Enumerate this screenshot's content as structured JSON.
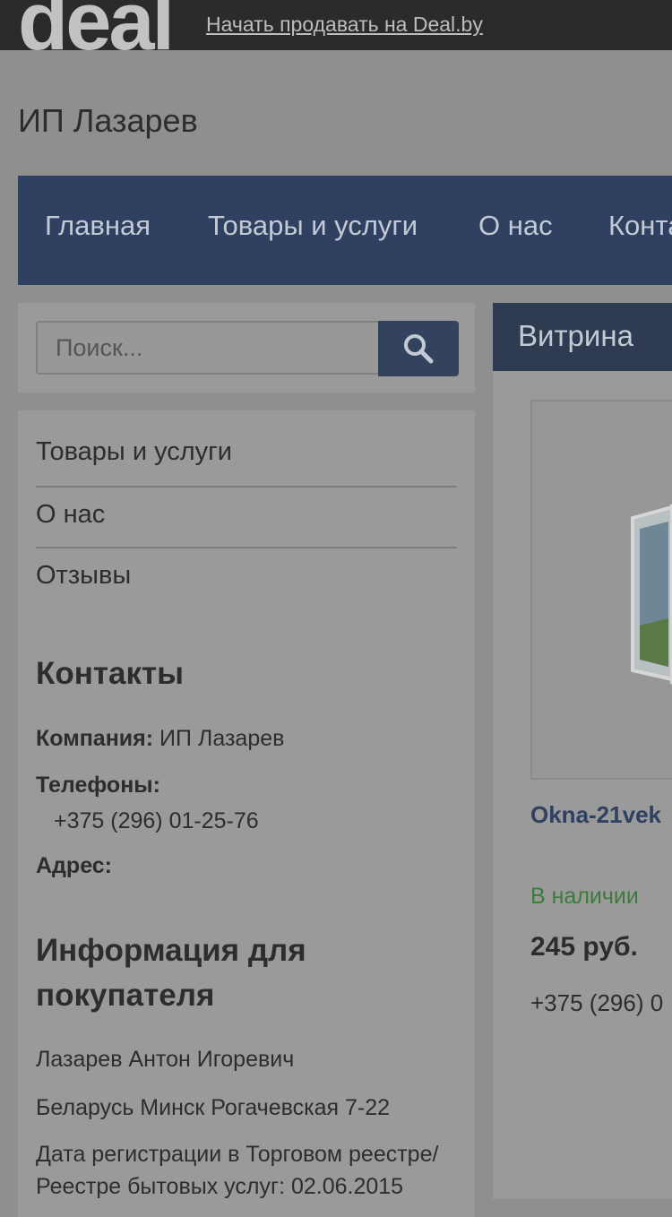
{
  "topbar": {
    "logo": "deal",
    "sell_link": "Начать продавать на Deal.by"
  },
  "shop": {
    "name": "ИП Лазарев"
  },
  "nav": {
    "items": [
      "Главная",
      "Товары и услуги",
      "О нас",
      "Конта"
    ]
  },
  "search": {
    "placeholder": "Поиск...",
    "button_icon": "search-icon"
  },
  "sidebar": {
    "menu": [
      "Товары и услуги",
      "О нас",
      "Отзывы"
    ],
    "contacts": {
      "title": "Контакты",
      "company_label": "Компания:",
      "company_value": "ИП Лазарев",
      "phones_label": "Телефоны:",
      "phone": "+375 (296) 01-25-76",
      "address_label": "Адрес:"
    },
    "info": {
      "title": "Информация для покупателя",
      "lines": [
        "Лазарев Антон Игоревич",
        "Беларусь Минск Рогачевская 7-22",
        "Дата регистрации в Торговом реестре/ Реестре бытовых услуг: 02.06.2015"
      ]
    }
  },
  "main": {
    "title": "Витрина",
    "product": {
      "name": "Okna-21vek",
      "stock": "В наличии",
      "price": "245 руб.",
      "phone": "+375 (296) 0"
    }
  },
  "colors": {
    "nav_bg": "#2f4060",
    "link": "#2f4060",
    "in_stock": "#3d7a3d"
  }
}
